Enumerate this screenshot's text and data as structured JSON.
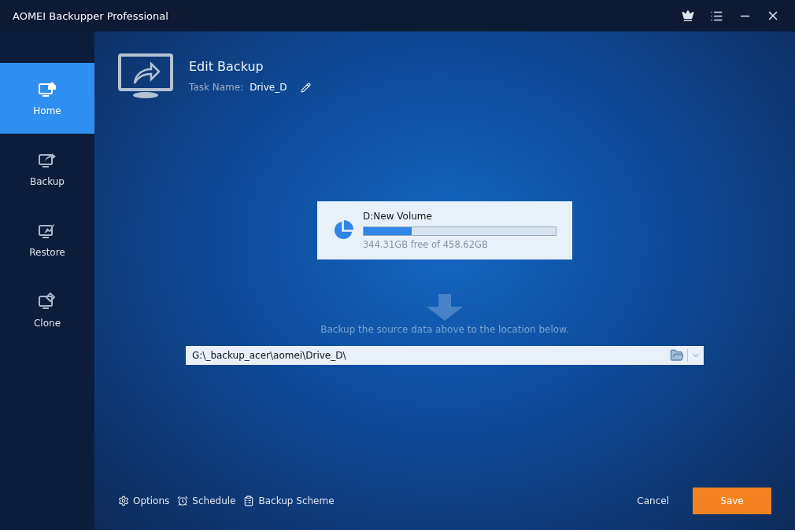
{
  "window": {
    "title": "AOMEI Backupper Professional"
  },
  "sidebar": {
    "items": [
      {
        "label": "Home",
        "kind": "home",
        "selected": true
      },
      {
        "label": "Backup",
        "kind": "backup",
        "selected": false
      },
      {
        "label": "Restore",
        "kind": "restore",
        "selected": false
      },
      {
        "label": "Clone",
        "kind": "clone",
        "selected": false
      }
    ]
  },
  "header": {
    "title": "Edit Backup",
    "task_label": "Task Name:",
    "task_name": "Drive_D"
  },
  "source": {
    "name": "D:New Volume",
    "level": 0.25,
    "capacity": "344.31GB free of 458.62GB"
  },
  "hint": "Backup the source data above to the location below.",
  "destination": {
    "value": "G:\\_backup_acer\\aomei\\Drive_D\\"
  },
  "footer": {
    "links": [
      {
        "label": "Options",
        "kind": "options"
      },
      {
        "label": "Schedule",
        "kind": "schedule"
      },
      {
        "label": "Backup Scheme",
        "kind": "scheme"
      }
    ],
    "cancel": "Cancel",
    "save": "Save"
  }
}
